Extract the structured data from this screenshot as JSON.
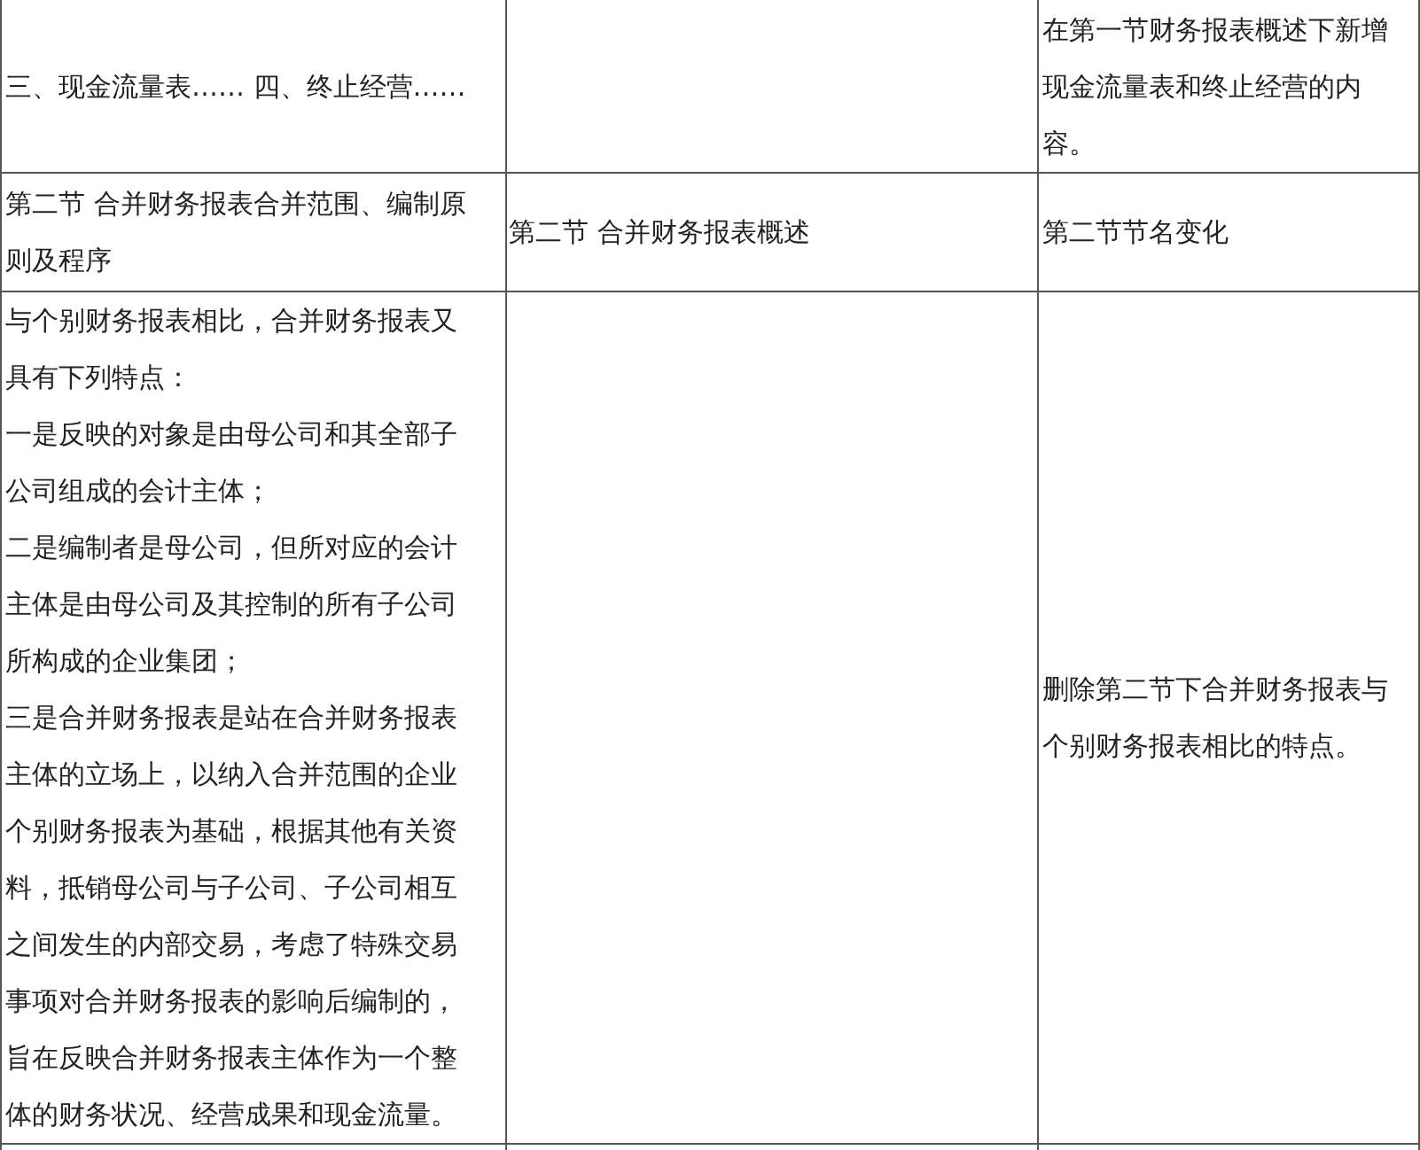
{
  "table": {
    "rows": [
      {
        "cells": [
          {
            "paragraphs": [
              "三、现金流量表…… 四、终止经营……"
            ]
          },
          {},
          {
            "paragraphs": [
              "在第一节财务报表概述下新增现金流量表和终止经营的内容。"
            ]
          }
        ]
      },
      {
        "cells": [
          {
            "paragraphs": [
              "第二节 合并财务报表合并范围、编制原则及程序"
            ]
          },
          {
            "paragraphs": [
              "第二节 合并财务报表概述"
            ]
          },
          {
            "paragraphs": [
              "第二节节名变化"
            ]
          }
        ]
      },
      {
        "cells": [
          {
            "paragraphs": [
              "与个别财务报表相比，合并财务报表又具有下列特点：",
              "一是反映的对象是由母公司和其全部子公司组成的会计主体；",
              "二是编制者是母公司，但所对应的会计主体是由母公司及其控制的所有子公司所构成的企业集团；",
              "三是合并财务报表是站在合并财务报表主体的立场上，以纳入合并范围的企业个别财务报表为基础，根据其他有关资料，抵销母公司与子公司、子公司相互之间发生的内部交易，考虑了特殊交易事项对合并财务报表的影响后编制的，旨在反映合并财务报表主体作为一个整体的财务状况、经营成果和现金流量。"
            ]
          },
          {},
          {
            "paragraphs": [
              "删除第二节下合并财务报表与个别财务报表相比的特点。"
            ]
          }
        ]
      }
    ]
  }
}
